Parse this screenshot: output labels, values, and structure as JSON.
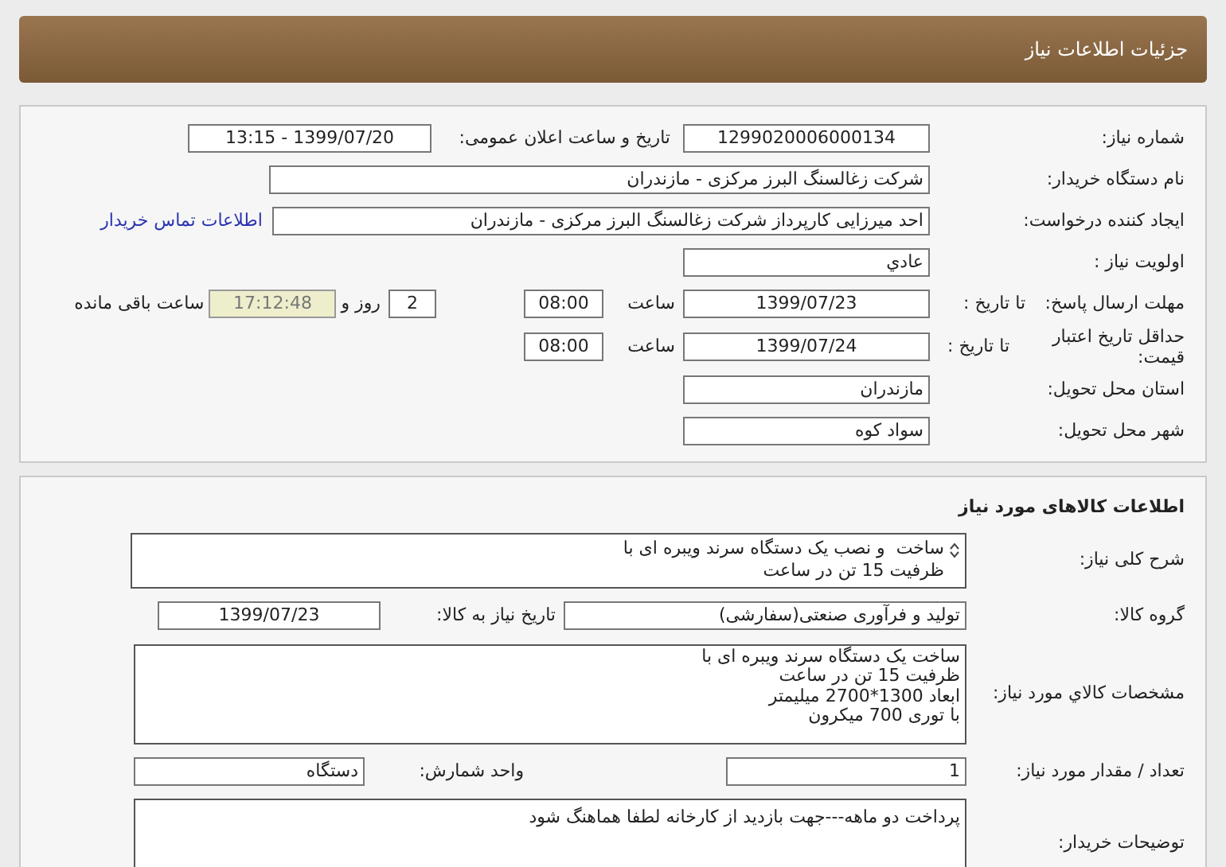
{
  "page_title": "جزئیات اطلاعات نیاز",
  "need_info": {
    "need_number": {
      "label": "شماره نیاز:",
      "value": "1299020006000134"
    },
    "announce": {
      "label": "تاریخ و ساعت اعلان عمومی:",
      "value": "1399/07/20 - 13:15"
    },
    "buyer_org": {
      "label": "نام دستگاه خریدار:",
      "value": "شرکت زغالسنگ البرز مرکزی - مازندران"
    },
    "requester": {
      "label": "ایجاد کننده درخواست:",
      "value": "احد میرزایی کارپرداز شرکت زغالسنگ البرز مرکزی - مازندران",
      "link": "اطلاعات تماس خریدار"
    },
    "priority": {
      "label": "اولویت نیاز :",
      "value": "عادي"
    },
    "reply_deadline": {
      "label": "مهلت ارسال پاسخ:",
      "sub_label": "تا تاریخ :",
      "date": "1399/07/23",
      "time_label": "ساعت",
      "time": "08:00",
      "days": "2",
      "days_label": "روز و",
      "remaining": "17:12:48",
      "remaining_label": "ساعت باقی مانده"
    },
    "price_validity": {
      "label": "حداقل تاریخ اعتبار قیمت:",
      "sub_label": "تا تاریخ :",
      "date": "1399/07/24",
      "time_label": "ساعت",
      "time": "08:00"
    },
    "province": {
      "label": "استان محل تحویل:",
      "value": "مازندران"
    },
    "city": {
      "label": "شهر محل تحویل:",
      "value": "سواد کوه"
    }
  },
  "goods": {
    "title": "اطلاعات کالاهای مورد نیاز",
    "summary": {
      "label": "شرح کلی نیاز:",
      "lines": [
        "ساخت  و نصب یک دستگاه سرند ویبره ای با",
        "ظرفیت 15 تن در ساعت"
      ]
    },
    "group": {
      "label": "گروه کالا:",
      "value": "تولید و فرآوری صنعتی(سفارشی)",
      "date_label": "تاریخ نیاز به کالا:",
      "date": "1399/07/23"
    },
    "specs": {
      "label": "مشخصات کالاي مورد نیاز:",
      "lines": [
        "ساخت یک دستگاه سرند ویبره ای با",
        "ظرفیت 15 تن در ساعت",
        "ابعاد 1300*2700 میلیمتر",
        "با توری 700 میکرون"
      ]
    },
    "quantity": {
      "label": "تعداد / مقدار مورد نیاز:",
      "value": "1",
      "unit_label": "واحد شمارش:",
      "unit": "دستگاه"
    },
    "buyer_notes": {
      "label": "توضیحات خریدار:",
      "value": "پرداخت دو ماهه---جهت بازدید از کارخانه لطفا هماهنگ شود"
    }
  }
}
